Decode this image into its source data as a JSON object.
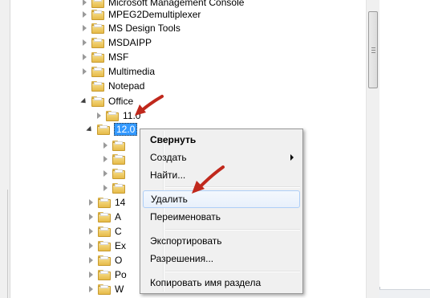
{
  "tree": {
    "items": [
      {
        "label": "Microsoft Management Console",
        "expanded": false
      },
      {
        "label": "MPEG2Demultiplexer",
        "expanded": false
      },
      {
        "label": "MS Design Tools",
        "expanded": false
      },
      {
        "label": "MSDAIPP",
        "expanded": false
      },
      {
        "label": "MSF",
        "expanded": false
      },
      {
        "label": "Multimedia",
        "expanded": false
      },
      {
        "label": "Notepad",
        "expanded": false
      },
      {
        "label": "Office",
        "expanded": true
      },
      {
        "label": "11.0",
        "expanded": false
      },
      {
        "label": "12.0",
        "expanded": true,
        "selected": true
      },
      {
        "label": "",
        "expanded": false
      },
      {
        "label": "",
        "expanded": false
      },
      {
        "label": "",
        "expanded": false
      },
      {
        "label": "",
        "expanded": false
      },
      {
        "label": "14",
        "expanded": false
      },
      {
        "label": "A",
        "expanded": false
      },
      {
        "label": "C",
        "expanded": false
      },
      {
        "label": "Ex",
        "expanded": false
      },
      {
        "label": "O",
        "expanded": false
      },
      {
        "label": "Po",
        "expanded": false
      },
      {
        "label": "W",
        "expanded": false
      }
    ]
  },
  "context_menu": {
    "items": [
      {
        "label": "Свернуть",
        "bold": true
      },
      {
        "label": "Создать",
        "submenu": true
      },
      {
        "label": "Найти..."
      },
      {
        "label": "Удалить",
        "highlighted": true
      },
      {
        "label": "Переименовать"
      },
      {
        "label": "Экспортировать"
      },
      {
        "label": "Разрешения..."
      },
      {
        "label": "Копировать имя раздела"
      }
    ]
  },
  "colors": {
    "annotation_arrow": "#c0281c",
    "selection": "#3399ff",
    "folder": "#e6bb48"
  }
}
